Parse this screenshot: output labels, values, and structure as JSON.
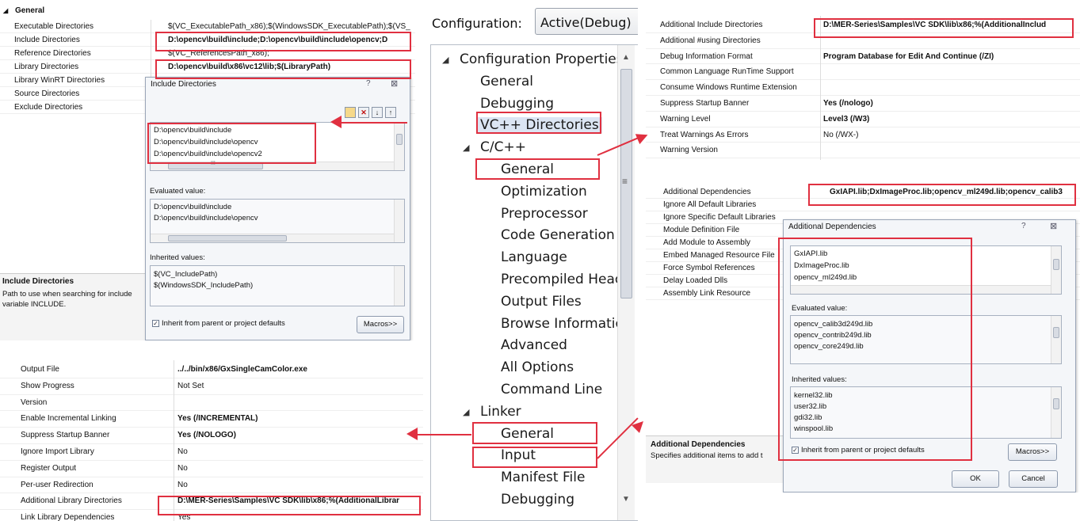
{
  "top_left": {
    "section": "General",
    "rows": [
      {
        "label": "Executable Directories",
        "value": "$(VC_ExecutablePath_x86);$(WindowsSDK_ExecutablePath);$(VS_",
        "bold": false
      },
      {
        "label": "Include Directories",
        "value": "D:\\opencv\\build\\include;D:\\opencv\\build\\include\\opencv;D",
        "bold": true
      },
      {
        "label": "Reference Directories",
        "value": "$(VC_ReferencesPath_x86);",
        "bold": false
      },
      {
        "label": "Library Directories",
        "value": "D:\\opencv\\build\\x86\\vc12\\lib;$(LibraryPath)",
        "bold": true
      },
      {
        "label": "Library WinRT Directories",
        "value": "",
        "bold": false
      },
      {
        "label": "Source Directories",
        "value": "",
        "bold": false
      },
      {
        "label": "Exclude Directories",
        "value": "",
        "bold": false
      }
    ],
    "desc_title": "Include Directories",
    "desc_text1": "Path to use when searching for include",
    "desc_text2": "variable INCLUDE."
  },
  "include_dialog": {
    "title": "Include Directories",
    "help": "?",
    "close": "⊠",
    "entries": [
      "D:\\opencv\\build\\include",
      "D:\\opencv\\build\\include\\opencv",
      "D:\\opencv\\build\\include\\opencv2"
    ],
    "evaluated_label": "Evaluated value:",
    "evaluated": [
      "D:\\opencv\\build\\include",
      "D:\\opencv\\build\\include\\opencv"
    ],
    "inherited_label": "Inherited values:",
    "inherited": [
      "$(VC_IncludePath)",
      "$(WindowsSDK_IncludePath)"
    ],
    "inherit_check": "Inherit from parent or project defaults",
    "macros": "Macros>>",
    "hscroll_grip": "III"
  },
  "bottom_left": {
    "rows": [
      {
        "label": "Output File",
        "value": "../../bin/x86/GxSingleCamColor.exe",
        "bold": true
      },
      {
        "label": "Show Progress",
        "value": "Not Set",
        "bold": false
      },
      {
        "label": "Version",
        "value": "",
        "bold": false
      },
      {
        "label": "Enable Incremental Linking",
        "value": "Yes (/INCREMENTAL)",
        "bold": true
      },
      {
        "label": "Suppress Startup Banner",
        "value": "Yes (/NOLOGO)",
        "bold": true
      },
      {
        "label": "Ignore Import Library",
        "value": "No",
        "bold": false
      },
      {
        "label": "Register Output",
        "value": "No",
        "bold": false
      },
      {
        "label": "Per-user Redirection",
        "value": "No",
        "bold": false
      },
      {
        "label": "Additional Library Directories",
        "value": "D:\\MER-Series\\Samples\\VC SDK\\lib\\x86;%(AdditionalLibrar",
        "bold": true
      },
      {
        "label": "Link Library Dependencies",
        "value": "Yes",
        "bold": false
      }
    ]
  },
  "center": {
    "config_label": "Configuration:",
    "config_value": "Active(Debug)",
    "tree": [
      {
        "text": "Configuration Properties",
        "level": 0,
        "expander": "◢"
      },
      {
        "text": "General",
        "level": 1
      },
      {
        "text": "Debugging",
        "level": 1
      },
      {
        "text": "VC++ Directories",
        "level": 1,
        "selected": true
      },
      {
        "text": "C/C++",
        "level": 1,
        "expander": "◢"
      },
      {
        "text": "General",
        "level": 2
      },
      {
        "text": "Optimization",
        "level": 2
      },
      {
        "text": "Preprocessor",
        "level": 2
      },
      {
        "text": "Code Generation",
        "level": 2
      },
      {
        "text": "Language",
        "level": 2
      },
      {
        "text": "Precompiled Heac",
        "level": 2
      },
      {
        "text": "Output Files",
        "level": 2
      },
      {
        "text": "Browse Informatic",
        "level": 2
      },
      {
        "text": "Advanced",
        "level": 2
      },
      {
        "text": "All Options",
        "level": 2
      },
      {
        "text": "Command Line",
        "level": 2
      },
      {
        "text": "Linker",
        "level": 1,
        "expander": "◢"
      },
      {
        "text": "General",
        "level": 2
      },
      {
        "text": "Input",
        "level": 2
      },
      {
        "text": "Manifest File",
        "level": 2
      },
      {
        "text": "Debugging",
        "level": 2
      }
    ],
    "scroll_up": "▲",
    "scroll_down": "▼",
    "scroll_grip": "≡"
  },
  "top_right": {
    "rows": [
      {
        "label": "Additional Include Directories",
        "value": "D:\\MER-Series\\Samples\\VC SDK\\lib\\x86;%(AdditionalInclud",
        "bold": true
      },
      {
        "label": "Additional #using Directories",
        "value": "",
        "bold": false
      },
      {
        "label": "Debug Information Format",
        "value": "Program Database for Edit And Continue (/ZI)",
        "bold": true
      },
      {
        "label": "Common Language RunTime Support",
        "value": "",
        "bold": false
      },
      {
        "label": "Consume Windows Runtime Extension",
        "value": "",
        "bold": false
      },
      {
        "label": "Suppress Startup Banner",
        "value": "Yes (/nologo)",
        "bold": true
      },
      {
        "label": "Warning Level",
        "value": "Level3 (/W3)",
        "bold": true
      },
      {
        "label": "Treat Warnings As Errors",
        "value": "No (/WX-)",
        "bold": false
      },
      {
        "label": "Warning Version",
        "value": "",
        "bold": false
      }
    ]
  },
  "bottom_right": {
    "rows": [
      {
        "label": "Additional Dependencies",
        "value": "GxIAPI.lib;DxImageProc.lib;opencv_ml249d.lib;opencv_calib3",
        "bold": true
      },
      {
        "label": "Ignore All Default Libraries",
        "value": ""
      },
      {
        "label": "Ignore Specific Default Libraries",
        "value": ""
      },
      {
        "label": "Module Definition File",
        "value": ""
      },
      {
        "label": "Add Module to Assembly",
        "value": ""
      },
      {
        "label": "Embed Managed Resource File",
        "value": ""
      },
      {
        "label": "Force Symbol References",
        "value": ""
      },
      {
        "label": "Delay Loaded Dlls",
        "value": ""
      },
      {
        "label": "Assembly Link Resource",
        "value": ""
      }
    ],
    "desc_title": "Additional Dependencies",
    "desc_text": "Specifies additional items to add t"
  },
  "deps_dialog": {
    "title": "Additional Dependencies",
    "help": "?",
    "close": "⊠",
    "entries": [
      "GxIAPI.lib",
      "DxImageProc.lib",
      "opencv_ml249d.lib"
    ],
    "evaluated_label": "Evaluated value:",
    "evaluated": [
      "opencv_calib3d249d.lib",
      "opencv_contrib249d.lib",
      "opencv_core249d.lib"
    ],
    "inherited_label": "Inherited values:",
    "inherited": [
      "kernel32.lib",
      "user32.lib",
      "gdi32.lib",
      "winspool.lib"
    ],
    "inherit_check": "Inherit from parent or project defaults",
    "macros": "Macros>>",
    "ok": "OK",
    "cancel": "Cancel"
  }
}
